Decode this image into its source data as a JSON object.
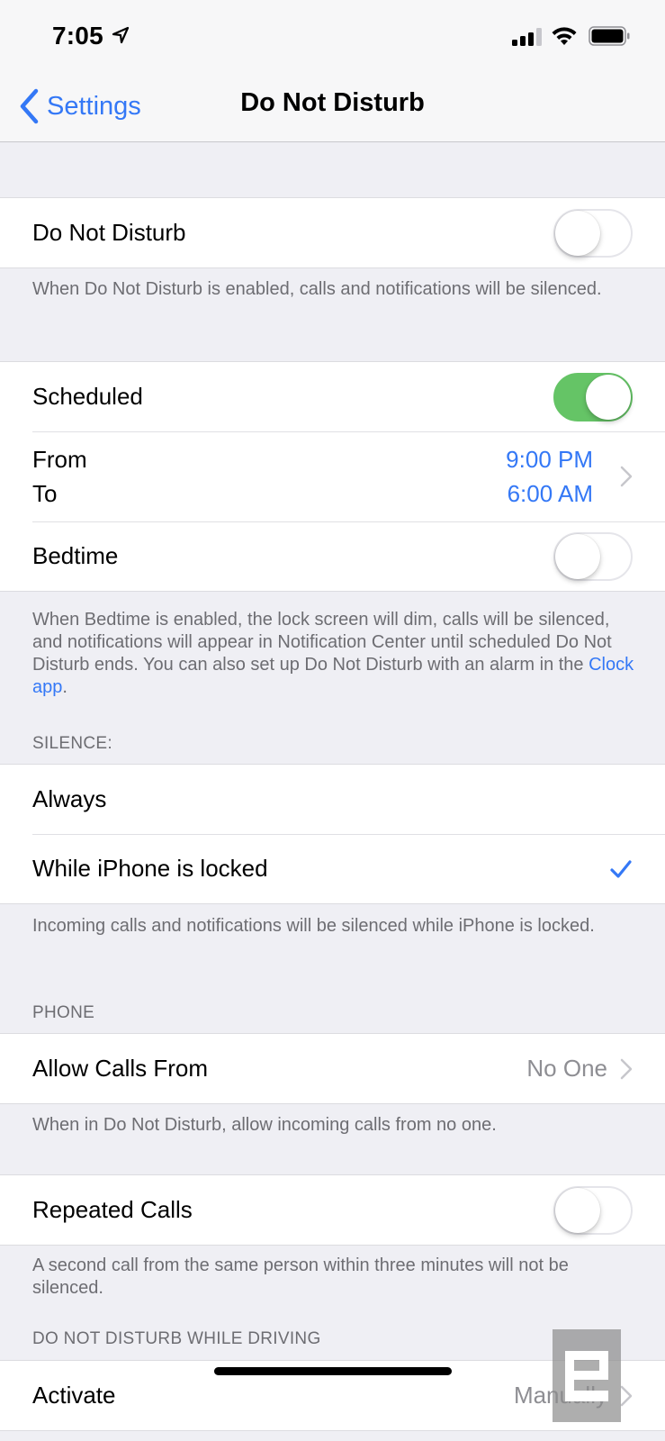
{
  "status_bar": {
    "time": "7:05",
    "icons": [
      "location-arrow-icon",
      "cellular-signal-icon",
      "wifi-icon",
      "battery-icon"
    ]
  },
  "nav": {
    "back_label": "Settings",
    "title": "Do Not Disturb"
  },
  "colors": {
    "accent": "#3478f6",
    "toggle_on": "#65c466",
    "background": "#efeff4",
    "secondary_text": "#6d6d72"
  },
  "dnd": {
    "label": "Do Not Disturb",
    "enabled": false,
    "footer": "When Do Not Disturb is enabled, calls and notifications will be silenced."
  },
  "schedule": {
    "scheduled_label": "Scheduled",
    "scheduled_enabled": true,
    "from_label": "From",
    "to_label": "To",
    "from_value": "9:00 PM",
    "to_value": "6:00 AM",
    "bedtime_label": "Bedtime",
    "bedtime_enabled": false,
    "footer_text": "When Bedtime is enabled, the lock screen will dim, calls will be silenced, and notifications will appear in Notification Center until scheduled Do Not Disturb ends. You can also set up Do Not Disturb with an alarm in the ",
    "footer_link": "Clock app",
    "footer_end": "."
  },
  "silence": {
    "header": "SILENCE:",
    "options": [
      {
        "label": "Always",
        "selected": false
      },
      {
        "label": "While iPhone is locked",
        "selected": true
      }
    ],
    "footer": "Incoming calls and notifications will be silenced while iPhone is locked."
  },
  "phone": {
    "header": "PHONE",
    "allow_calls_label": "Allow Calls From",
    "allow_calls_value": "No One",
    "allow_calls_footer": "When in Do Not Disturb, allow incoming calls from no one.",
    "repeated_calls_label": "Repeated Calls",
    "repeated_calls_enabled": false,
    "repeated_calls_footer": "A second call from the same person within three minutes will not be silenced."
  },
  "driving": {
    "header": "DO NOT DISTURB WHILE DRIVING",
    "activate_label": "Activate",
    "activate_value": "Manually"
  }
}
